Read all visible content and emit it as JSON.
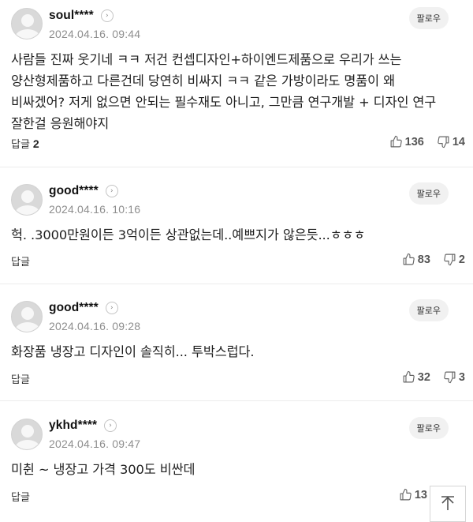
{
  "follow_label": "팔로우",
  "reply_label": "답글",
  "icons": {
    "like": "thumbs-up-icon",
    "dislike": "thumbs-down-icon",
    "profile": "chevron-right-icon",
    "top": "arrow-up-icon"
  },
  "comments": [
    {
      "username": "soul****",
      "date": "2024.04.16. 09:44",
      "text": "사람들 진짜 웃기네 ㅋㅋ 저건 컨셉디자인+하이엔드제품으로 우리가 쓰는 양산형제품하고 다른건데 당연히 비싸지 ㅋㅋ 같은 가방이라도 명품이 왜 비싸겠어? 저게 없으면 안되는 필수재도 아니고, 그만큼 연구개발 + 디자인 연구 잘한걸 응원해야지",
      "reply_count": "2",
      "likes": "136",
      "dislikes": "14"
    },
    {
      "username": "good****",
      "date": "2024.04.16. 10:16",
      "text": "헉. .3000만원이든 3억이든 상관없는데..예쁘지가 않은듯...ㅎㅎㅎ",
      "reply_count": "",
      "likes": "83",
      "dislikes": "2"
    },
    {
      "username": "good****",
      "date": "2024.04.16. 09:28",
      "text": "화장품 냉장고 디자인이 솔직히... 투박스럽다.",
      "reply_count": "",
      "likes": "32",
      "dislikes": "3"
    },
    {
      "username": "ykhd****",
      "date": "2024.04.16. 09:47",
      "text": "미췬 ~ 냉장고 가격 300도 비싼데",
      "reply_count": "",
      "likes": "13",
      "dislikes": ""
    }
  ]
}
